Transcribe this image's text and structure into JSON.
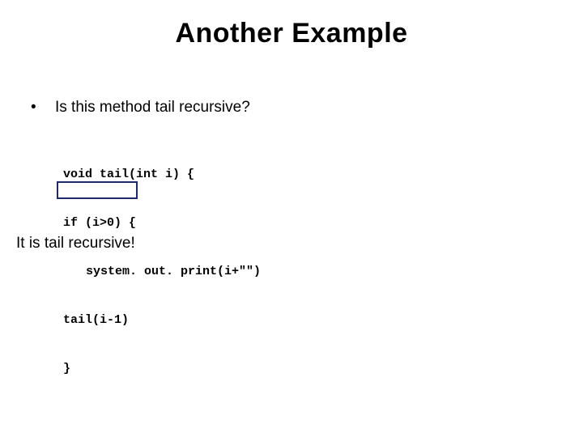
{
  "title": "Another Example",
  "bullet": {
    "marker": "•",
    "text": "Is this method tail recursive?"
  },
  "code": {
    "l1": "void tail(int i) {",
    "l2": "if (i>0) {",
    "l3": "system. out. print(i+\"\")",
    "l4": "tail(i-1)",
    "l5": "}"
  },
  "conclusion": "It is tail recursive!"
}
